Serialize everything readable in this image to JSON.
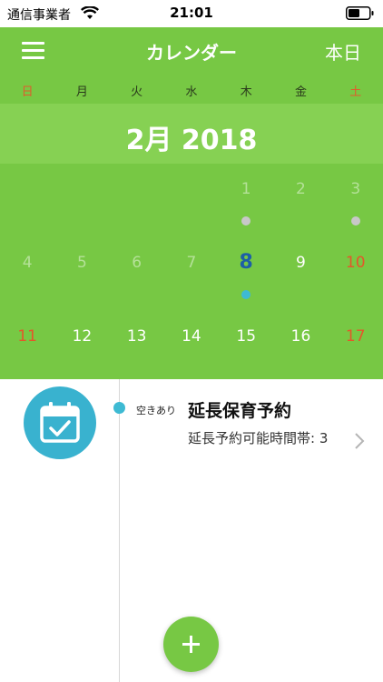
{
  "status_bar": {
    "carrier": "通信事業者",
    "time": "21:01"
  },
  "nav": {
    "title": "カレンダー",
    "today_label": "本日",
    "menu_icon": "hamburger-menu-icon"
  },
  "weekdays": [
    "日",
    "月",
    "火",
    "水",
    "木",
    "金",
    "土"
  ],
  "month_label": "2月 2018",
  "calendar": {
    "weeks": [
      [
        {
          "day": "",
          "state": "empty"
        },
        {
          "day": "",
          "state": "empty"
        },
        {
          "day": "",
          "state": "empty"
        },
        {
          "day": "",
          "state": "empty"
        },
        {
          "day": "1",
          "state": "muted",
          "dot": "grey"
        },
        {
          "day": "2",
          "state": "muted"
        },
        {
          "day": "3",
          "state": "muted",
          "dot": "grey"
        }
      ],
      [
        {
          "day": "4",
          "state": "muted"
        },
        {
          "day": "5",
          "state": "muted"
        },
        {
          "day": "6",
          "state": "muted"
        },
        {
          "day": "7",
          "state": "muted"
        },
        {
          "day": "8",
          "state": "today",
          "dot": "blue"
        },
        {
          "day": "9",
          "state": "normal"
        },
        {
          "day": "10",
          "state": "weekend"
        }
      ],
      [
        {
          "day": "11",
          "state": "weekend"
        },
        {
          "day": "12",
          "state": "normal"
        },
        {
          "day": "13",
          "state": "normal"
        },
        {
          "day": "14",
          "state": "normal"
        },
        {
          "day": "15",
          "state": "normal"
        },
        {
          "day": "16",
          "state": "normal"
        },
        {
          "day": "17",
          "state": "weekend"
        }
      ]
    ]
  },
  "event": {
    "availability": "空きあり",
    "title": "延長保育予約",
    "detail": "延長予約可能時間帯: 3",
    "icon": "calendar-check-icon"
  },
  "colors": {
    "primary_green": "#77c844",
    "banner_green": "#86d153",
    "accent_blue": "#39b2cf",
    "weekend_red": "#e4572a",
    "today_blue": "#1d5fa6"
  }
}
